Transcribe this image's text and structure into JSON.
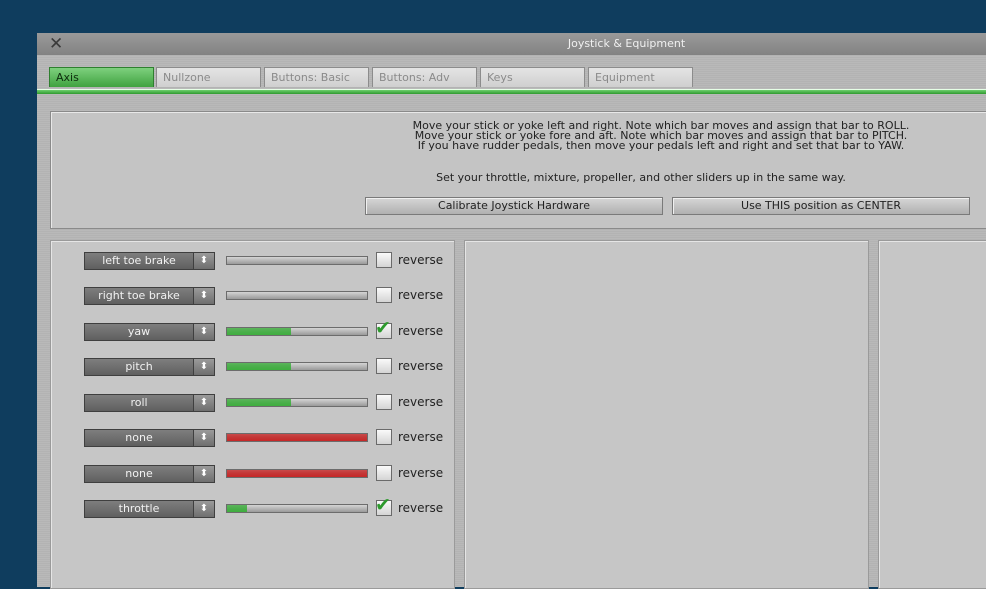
{
  "window": {
    "title": "Joystick & Equipment"
  },
  "tabs": [
    {
      "label": "Axis"
    },
    {
      "label": "Nullzone"
    },
    {
      "label": "Buttons: Basic"
    },
    {
      "label": "Buttons: Adv"
    },
    {
      "label": "Keys"
    },
    {
      "label": "Equipment"
    }
  ],
  "info": {
    "line1": "Move your stick or yoke left and right. Note which bar moves and assign that bar to ROLL.",
    "line2": "Move your stick or yoke fore and aft. Note which bar moves and assign that bar to PITCH.",
    "line3": "If you have rudder pedals, then move your pedals left and right and set that bar to YAW.",
    "line4": "Set your throttle, mixture, propeller, and other sliders up in the same way.",
    "calibrate_button": "Calibrate Joystick Hardware",
    "center_button": "Use THIS position as CENTER"
  },
  "axes": [
    {
      "assignment": "left toe brake",
      "bar_fraction": 0.0,
      "bar_color": "#888888",
      "reverse": false,
      "reverse_label": "reverse"
    },
    {
      "assignment": "right toe brake",
      "bar_fraction": 0.0,
      "bar_color": "#888888",
      "reverse": false,
      "reverse_label": "reverse"
    },
    {
      "assignment": "yaw",
      "bar_fraction": 0.46,
      "bar_color": "#3fae3f",
      "reverse": true,
      "reverse_label": "reverse"
    },
    {
      "assignment": "pitch",
      "bar_fraction": 0.46,
      "bar_color": "#3fae3f",
      "reverse": false,
      "reverse_label": "reverse"
    },
    {
      "assignment": "roll",
      "bar_fraction": 0.46,
      "bar_color": "#3fae3f",
      "reverse": false,
      "reverse_label": "reverse"
    },
    {
      "assignment": "none",
      "bar_fraction": 1.0,
      "bar_color": "#c62828",
      "reverse": false,
      "reverse_label": "reverse"
    },
    {
      "assignment": "none",
      "bar_fraction": 1.0,
      "bar_color": "#c62828",
      "reverse": false,
      "reverse_label": "reverse"
    },
    {
      "assignment": "throttle",
      "bar_fraction": 0.14,
      "bar_color": "#3fae3f",
      "reverse": true,
      "reverse_label": "reverse"
    }
  ],
  "icons": {
    "close": "close-icon",
    "dropdown": "updown-arrow-icon",
    "check": "checkmark-icon"
  },
  "colors": {
    "accent_green": "#3fa23f",
    "bar_red": "#c62828",
    "desktop": "#0f3d5e"
  }
}
